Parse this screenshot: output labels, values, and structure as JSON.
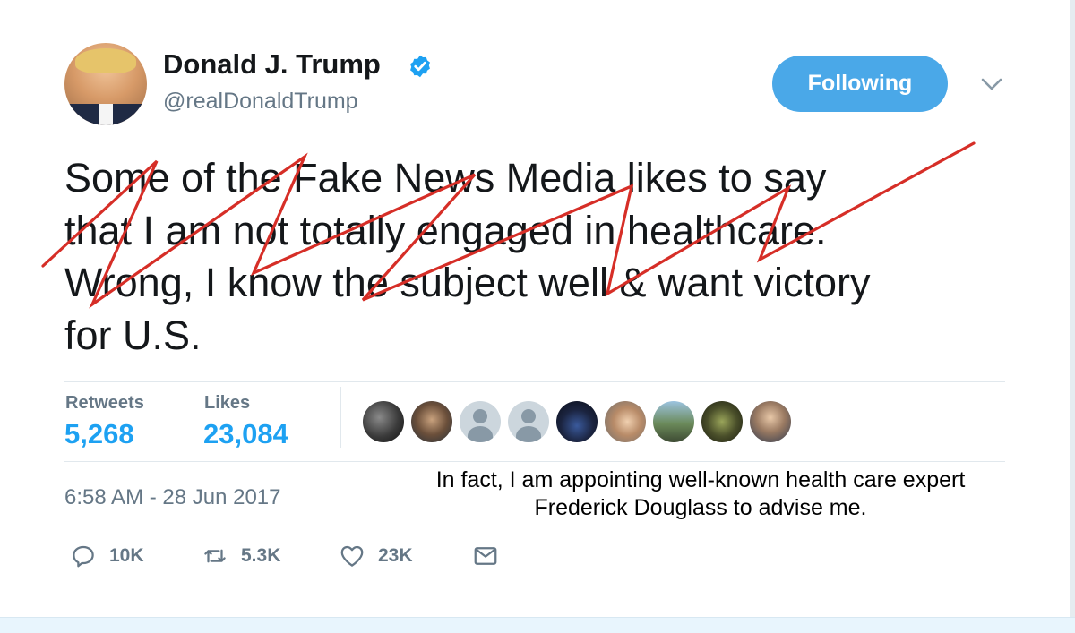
{
  "profile": {
    "name": "Donald J. Trump",
    "handle": "@realDonaldTrump"
  },
  "follow_button": {
    "label": "Following"
  },
  "tweet": {
    "text": "Some of the Fake News Media likes to say\nthat I am not totally engaged in healthcare.\nWrong, I know the subject well & want victory\nfor U.S."
  },
  "stats": {
    "retweets_label": "Retweets",
    "retweets_value": "5,268",
    "likes_label": "Likes",
    "likes_value": "23,084"
  },
  "timestamp": "6:58 AM - 28 Jun 2017",
  "caption": {
    "line1": "In fact, I am appointing well-known health care expert",
    "line2": "Frederick Douglass to advise me."
  },
  "actions": {
    "replies": "10K",
    "retweets": "5.3K",
    "likes": "23K"
  },
  "colors": {
    "accent": "#1da1f2",
    "follow_button": "#4aa8e8",
    "scribble": "#d62e27"
  },
  "icons": {
    "verified": "verified-badge-icon",
    "chevron": "chevron-down-icon",
    "reply": "reply-icon",
    "retweet": "retweet-icon",
    "like": "heart-icon",
    "message": "envelope-icon"
  }
}
